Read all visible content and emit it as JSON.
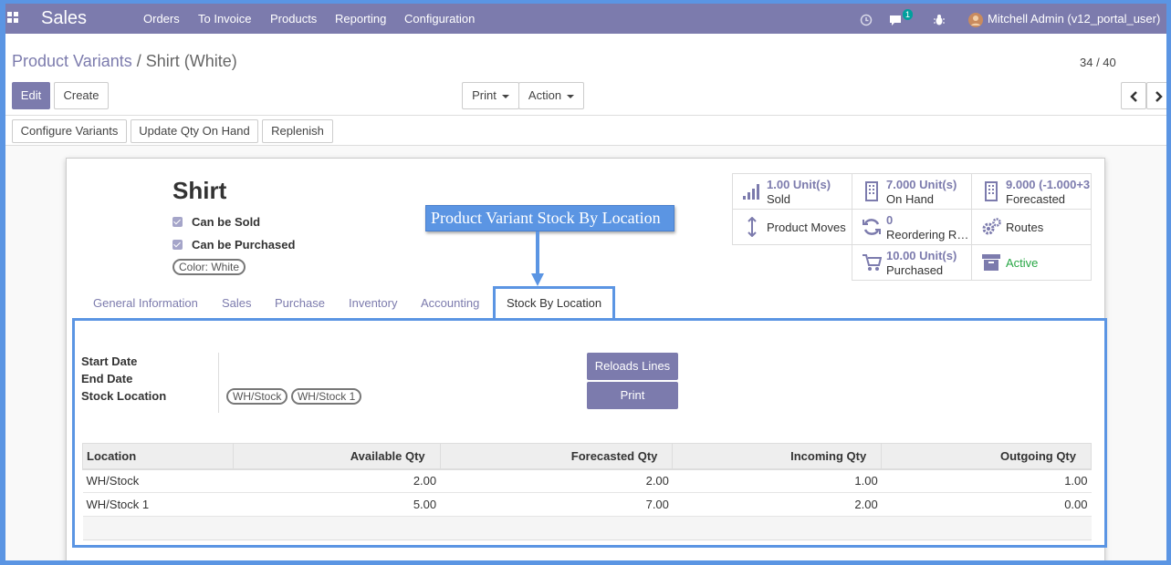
{
  "topbar": {
    "app": "Sales",
    "menu": [
      "Orders",
      "To Invoice",
      "Products",
      "Reporting",
      "Configuration"
    ],
    "chat_count": "1",
    "user": "Mitchell Admin (v12_portal_user)"
  },
  "breadcrumb": {
    "parent": "Product Variants",
    "sep": "/",
    "current": "Shirt (White)"
  },
  "buttons": {
    "edit": "Edit",
    "create": "Create",
    "print": "Print",
    "action": "Action",
    "pager": "34 / 40",
    "configure": "Configure Variants",
    "update_qty": "Update Qty On Hand",
    "replenish": "Replenish"
  },
  "product": {
    "name": "Shirt",
    "can_be_sold": "Can be Sold",
    "can_be_purchased": "Can be Purchased",
    "variant_tag": "Color: White"
  },
  "stats": {
    "sold_val": "1.00 Unit(s)",
    "sold_lbl": "Sold",
    "onhand_val": "7.000 Unit(s)",
    "onhand_lbl": "On Hand",
    "forecast_val": "9.000 (-1.000+3",
    "forecast_lbl": "Forecasted",
    "moves": "Product Moves",
    "reorder_val": "0",
    "reorder_lbl": "Reordering Rules",
    "routes": "Routes",
    "purch_val": "10.00 Unit(s)",
    "purch_lbl": "Purchased",
    "active": "Active"
  },
  "callout": "Product Variant Stock By Location",
  "tabs": [
    "General Information",
    "Sales",
    "Purchase",
    "Inventory",
    "Accounting",
    "Stock By Location"
  ],
  "form": {
    "start_date": "Start Date",
    "end_date": "End Date",
    "stock_location": "Stock Location",
    "locations": [
      "WH/Stock",
      "WH/Stock 1"
    ],
    "reload": "Reloads Lines",
    "print": "Print"
  },
  "table": {
    "headers": [
      "Location",
      "Available Qty",
      "Forecasted Qty",
      "Incoming Qty",
      "Outgoing Qty"
    ],
    "rows": [
      [
        "WH/Stock",
        "2.00",
        "2.00",
        "1.00",
        "1.00"
      ],
      [
        "WH/Stock 1",
        "5.00",
        "7.00",
        "2.00",
        "0.00"
      ]
    ]
  }
}
